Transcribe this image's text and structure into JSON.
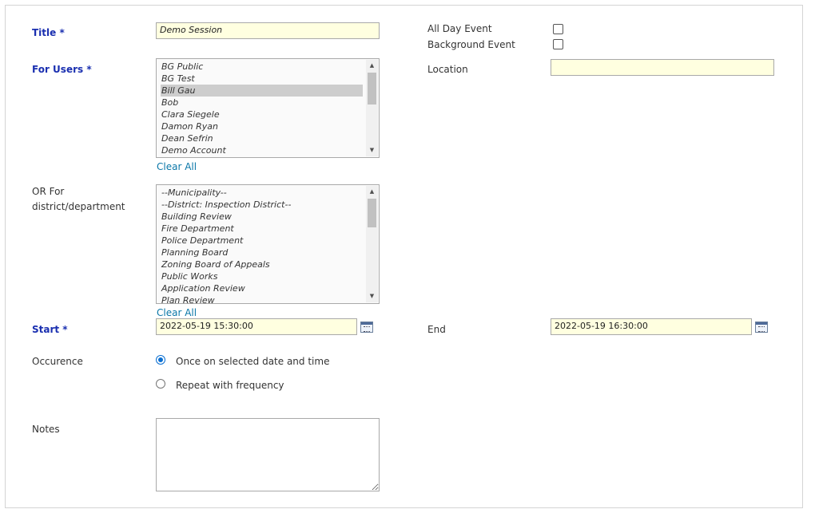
{
  "form": {
    "title_label": "Title *",
    "title_value": "Demo Session",
    "for_users_label": "For Users *",
    "users": [
      {
        "name": "BG Public",
        "selected": false
      },
      {
        "name": "BG Test",
        "selected": false
      },
      {
        "name": "Bill Gau",
        "selected": true
      },
      {
        "name": "Bob",
        "selected": false
      },
      {
        "name": "Clara Siegele",
        "selected": false
      },
      {
        "name": "Damon Ryan",
        "selected": false
      },
      {
        "name": "Dean Sefrin",
        "selected": false
      },
      {
        "name": "Demo Account",
        "selected": false
      }
    ],
    "clear_all_users": "Clear All",
    "district_label_line1": "OR For",
    "district_label_line2": "district/department",
    "districts": [
      "--Municipality--",
      "--District: Inspection District--",
      "Building Review",
      "Fire Department",
      "Police Department",
      "Planning Board",
      "Zoning Board of Appeals",
      "Public Works",
      "Application Review",
      "Plan Review"
    ],
    "clear_all_districts": "Clear All",
    "start_label": "Start *",
    "start_value": "2022-05-19 15:30:00",
    "end_label": "End",
    "end_value": "2022-05-19 16:30:00",
    "occurrence_label": "Occurence",
    "occurrence_options": [
      "Once on selected date and time",
      "Repeat with frequency"
    ],
    "occurrence_selected": "Once on selected date and time",
    "notes_label": "Notes",
    "notes_value": "",
    "all_day_label": "All Day Event",
    "all_day_checked": false,
    "background_label": "Background Event",
    "background_checked": false,
    "location_label": "Location",
    "location_value": ""
  },
  "colors": {
    "required_label": "#1a2fb0",
    "input_bg": "#ffffe0",
    "link": "#0a77a8",
    "selected_item": "#cdcdcd"
  }
}
